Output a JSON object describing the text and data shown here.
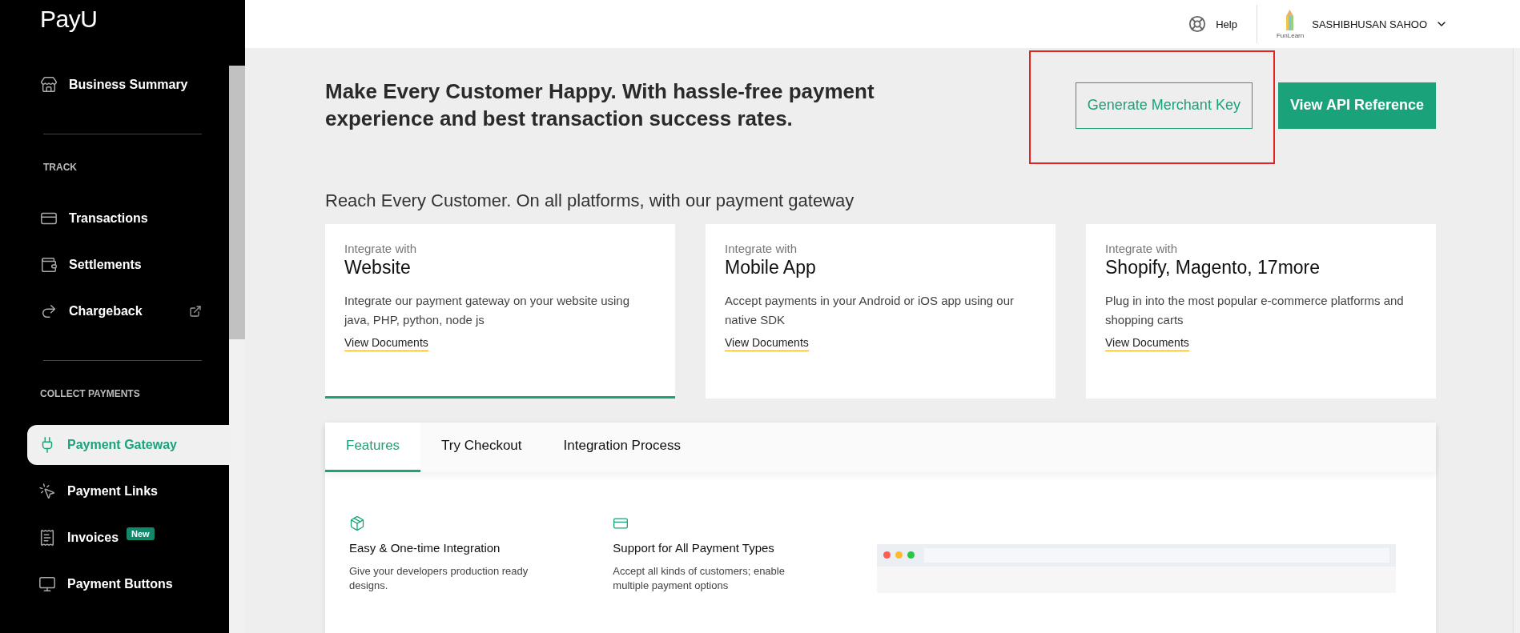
{
  "logo": "PayU",
  "sidebar": {
    "sections": [
      {
        "items": [
          {
            "label": "Business Summary",
            "selected": false
          }
        ]
      },
      {
        "heading": "TRACK",
        "items": [
          {
            "label": "Transactions",
            "selected": false
          },
          {
            "label": "Settlements",
            "selected": false
          },
          {
            "label": "Chargeback",
            "selected": false,
            "external": true
          }
        ]
      },
      {
        "heading": "COLLECT PAYMENTS",
        "items": [
          {
            "label": "Payment Gateway",
            "selected": true
          },
          {
            "label": "Payment Links",
            "selected": false
          },
          {
            "label": "Invoices",
            "selected": false,
            "badge": "New"
          },
          {
            "label": "Payment Buttons",
            "selected": false
          }
        ]
      }
    ]
  },
  "header": {
    "help": "Help",
    "brand_caption": "FunLearn",
    "user": "SASHIBHUSAN SAHOO"
  },
  "hero": {
    "headline": "Make Every Customer Happy. With hassle-free payment experience and best transaction success rates.",
    "buttons": [
      {
        "label": "Generate Merchant Key",
        "kind": "outline",
        "highlighted": true
      },
      {
        "label": "View API Reference",
        "kind": "solid",
        "highlighted": false
      }
    ]
  },
  "subheading": "Reach Every Customer. On all platforms, with our payment gateway",
  "cards": [
    {
      "eyebrow": "Integrate with",
      "title": "Website",
      "text": "Integrate our payment gateway on your website using java, PHP, python, node js",
      "link": "View Documents",
      "selected": true
    },
    {
      "eyebrow": "Integrate with",
      "title": "Mobile App",
      "text": "Accept payments in your Android or iOS app using our native SDK",
      "link": "View Documents",
      "selected": false
    },
    {
      "eyebrow": "Integrate with",
      "title": "Shopify, Magento, 17more",
      "text": "Plug in into the most popular e-commerce platforms and shopping carts",
      "link": "View Documents",
      "selected": false
    }
  ],
  "tabs": [
    {
      "label": "Features",
      "selected": true
    },
    {
      "label": "Try Checkout",
      "selected": false
    },
    {
      "label": "Integration Process",
      "selected": false
    }
  ],
  "features": [
    {
      "title": "Easy & One-time Integration",
      "text": "Give your developers production ready designs."
    },
    {
      "title": "Support for All Payment Types",
      "text": "Accept all kinds of customers; enable multiple payment options"
    }
  ]
}
